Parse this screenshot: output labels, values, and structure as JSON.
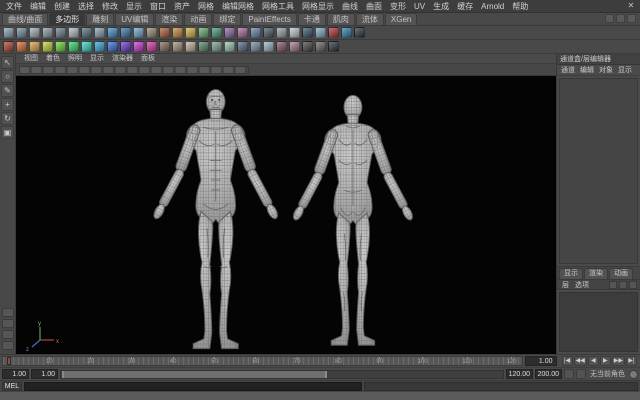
{
  "titlebar": {
    "close_label": "✕"
  },
  "menus": [
    "文件",
    "编辑",
    "创建",
    "选择",
    "修改",
    "显示",
    "窗口",
    "资产",
    "网格",
    "编辑网格",
    "网格工具",
    "网格显示",
    "曲线",
    "曲面",
    "变形",
    "UV",
    "生成",
    "缓存",
    "Arnold",
    "帮助"
  ],
  "shelf": {
    "tabs": [
      {
        "label": "曲线/曲面",
        "active": false
      },
      {
        "label": "多边形",
        "active": true
      },
      {
        "label": "雕刻",
        "active": false
      },
      {
        "label": "UV编辑",
        "active": false
      },
      {
        "label": "渲染",
        "active": false
      },
      {
        "label": "动画",
        "active": false
      },
      {
        "label": "绑定",
        "active": false
      },
      {
        "label": "PaintEffects",
        "active": false
      },
      {
        "label": "卡通",
        "active": false
      },
      {
        "label": "肌肉",
        "active": false
      },
      {
        "label": "流体",
        "active": false
      },
      {
        "label": "XGen",
        "active": false
      }
    ],
    "row1_icon_colors": [
      "#8fa8b8",
      "#7a93a3",
      "#a7b4bc",
      "#93a0a8",
      "#6f8795",
      "#b7c1c7",
      "#5d7585",
      "#8fa8b8",
      "#4a90c4",
      "#3f7cab",
      "#77a9cf",
      "#9c8f7a",
      "#b0643f",
      "#c98f3f",
      "#d9b84f",
      "#6faf6f",
      "#4f9f80",
      "#8f6fae",
      "#ae6f9f",
      "#6f86ae",
      "#50616c",
      "#9aa5ad",
      "#c4cdd2",
      "#3d5a6e",
      "#86b0c8",
      "#b03a3a",
      "#3a7fb0",
      "#303a40"
    ],
    "row2_icon_colors": [
      "#b04a3a",
      "#d9713f",
      "#e0a84f",
      "#c8d93f",
      "#6fd93f",
      "#3fd971",
      "#3fd9c8",
      "#3fa8d9",
      "#3f71d9",
      "#713fd9",
      "#c83fd9",
      "#d93fa8",
      "#8a6f5d",
      "#a8947f",
      "#c8b89e",
      "#5d8a6f",
      "#7fa894",
      "#9ec8b8",
      "#5d6f8a",
      "#7f94a8",
      "#9eb8c8",
      "#8a5d6f",
      "#a87f94",
      "#4a4a4a",
      "#6a6a6a",
      "#2f3a44"
    ]
  },
  "toolbox": {
    "tools": [
      {
        "name": "select-tool",
        "glyph": "↖"
      },
      {
        "name": "lasso-tool",
        "glyph": "○"
      },
      {
        "name": "paint-select-tool",
        "glyph": "✎"
      },
      {
        "name": "move-tool",
        "glyph": "+"
      },
      {
        "name": "rotate-tool",
        "glyph": "↻"
      },
      {
        "name": "scale-tool",
        "glyph": "▣"
      }
    ]
  },
  "panel_menus": [
    "视图",
    "着色",
    "照明",
    "显示",
    "渲染器",
    "面板"
  ],
  "viewport_axis": {
    "x": "x",
    "y": "y",
    "z": "z"
  },
  "channel_box": {
    "title": "通道盒/层编辑器",
    "menus": [
      "通道",
      "编辑",
      "对象",
      "显示"
    ]
  },
  "layer_editor": {
    "tabs": [
      "显示",
      "渲染",
      "动画"
    ],
    "menus": [
      "层",
      "选项"
    ]
  },
  "timeline": {
    "ticks": [
      "1",
      "10",
      "20",
      "30",
      "40",
      "50",
      "60",
      "70",
      "80",
      "90",
      "100",
      "110",
      "120"
    ],
    "current_frame": "1.00"
  },
  "playback": {
    "buttons": [
      {
        "name": "go-to-start",
        "glyph": "|◀"
      },
      {
        "name": "step-back-key",
        "glyph": "◀◀"
      },
      {
        "name": "play-backward",
        "glyph": "◀"
      },
      {
        "name": "play-forward",
        "glyph": "▶"
      },
      {
        "name": "step-forward-key",
        "glyph": "▶▶"
      },
      {
        "name": "go-to-end",
        "glyph": "▶|"
      }
    ]
  },
  "range_bar": {
    "anim_start": "1.00",
    "play_start": "1.00",
    "play_end": "120.00",
    "anim_end": "200.00",
    "character_set": "无当前角色"
  },
  "command_line": {
    "label": "MEL",
    "value": ""
  },
  "help_line": {
    "text": ""
  }
}
